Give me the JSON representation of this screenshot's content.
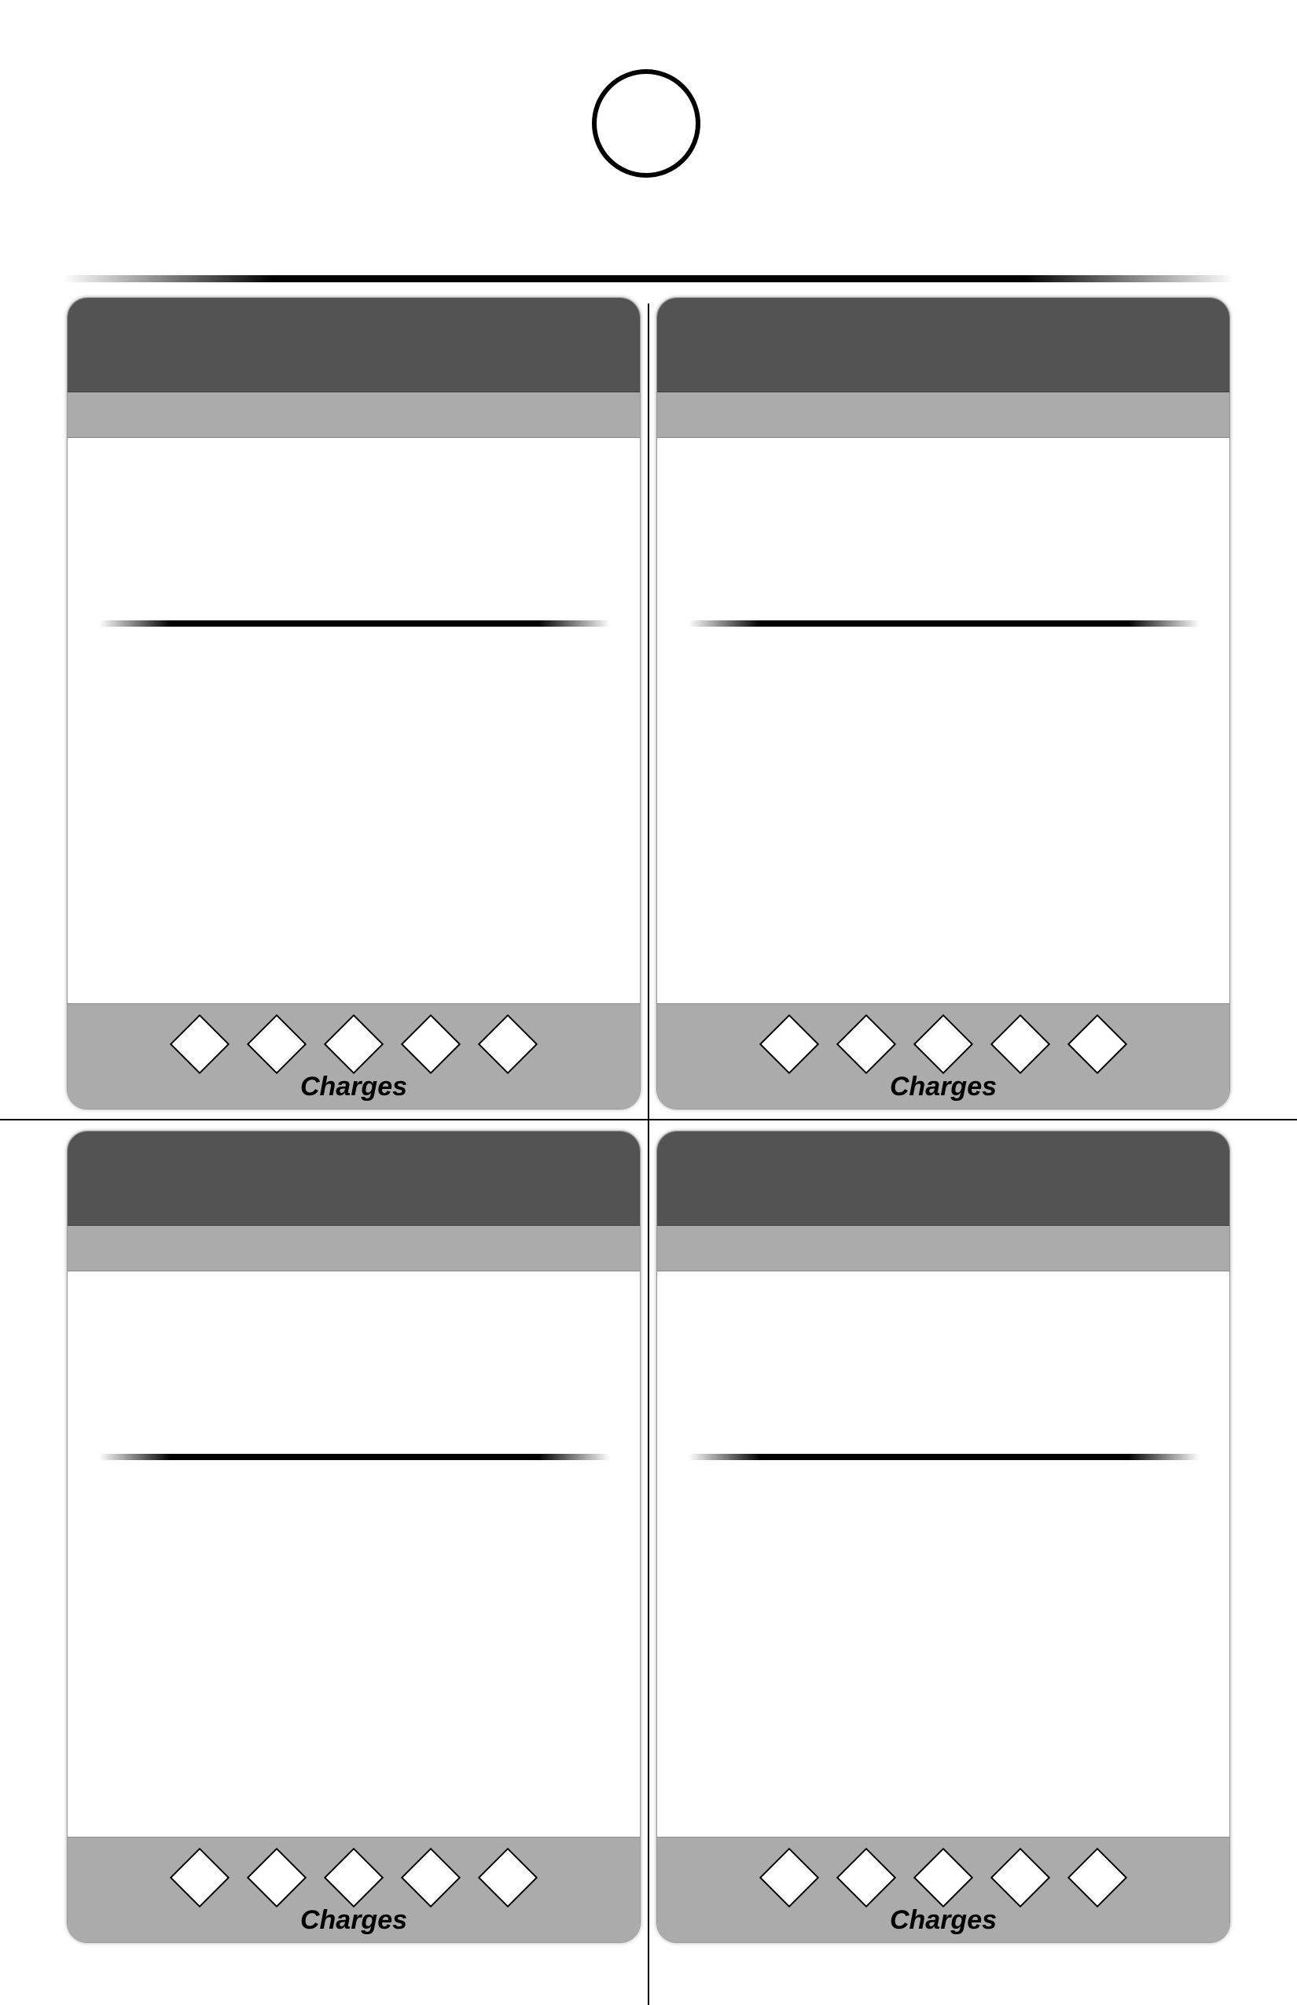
{
  "sheet": {
    "cards": [
      {
        "footer": {
          "charge_count": 5,
          "label": "Charges"
        }
      },
      {
        "footer": {
          "charge_count": 5,
          "label": "Charges"
        }
      },
      {
        "footer": {
          "charge_count": 5,
          "label": "Charges"
        }
      },
      {
        "footer": {
          "charge_count": 5,
          "label": "Charges"
        }
      }
    ]
  },
  "colors": {
    "title_bar": "#535353",
    "subtitle_bar": "#ababab",
    "footer": "#ababab",
    "background": "#ffffff"
  },
  "icons": {
    "emblem": "circle-outline",
    "charge": "diamond-outline"
  }
}
